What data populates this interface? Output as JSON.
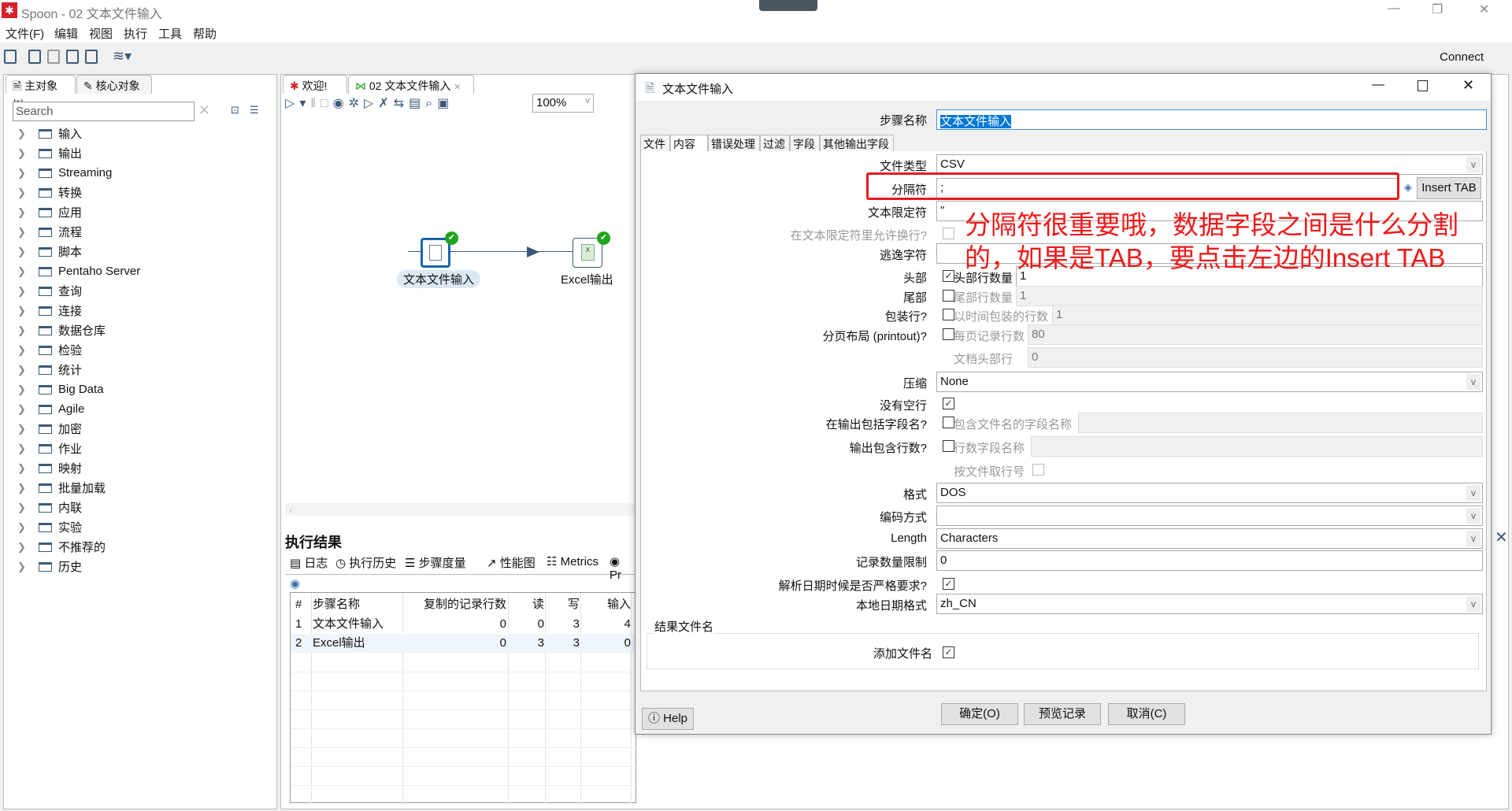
{
  "window": {
    "title": "Spoon - 02 文本文件输入",
    "minimize": "—",
    "restore": "❐",
    "close": "✕"
  },
  "menu": [
    "文件(F)",
    "编辑",
    "视图",
    "执行",
    "工具",
    "帮助"
  ],
  "toolbar": {
    "connect": "Connect"
  },
  "left_panel": {
    "tabs": [
      "主对象树",
      "核心对象"
    ],
    "search_placeholder": "Search",
    "tree": [
      "输入",
      "输出",
      "Streaming",
      "转换",
      "应用",
      "流程",
      "脚本",
      "Pentaho Server",
      "查询",
      "连接",
      "数据仓库",
      "检验",
      "统计",
      "Big Data",
      "Agile",
      "加密",
      "作业",
      "映射",
      "批量加载",
      "内联",
      "实验",
      "不推荐的",
      "历史"
    ]
  },
  "center": {
    "tabs": [
      "欢迎!",
      "02 文本文件输入"
    ],
    "zoom": "100%",
    "nodes": [
      {
        "label": "文本文件输入",
        "icon": "text-file-input-icon"
      },
      {
        "label": "Excel输出",
        "icon": "excel-output-icon"
      }
    ],
    "results": {
      "title": "执行结果",
      "tabs": [
        "日志",
        "执行历史",
        "步骤度量",
        "性能图",
        "Metrics",
        "Pr"
      ],
      "columns": [
        "#",
        "步骤名称",
        "复制的记录行数",
        "读",
        "写",
        "输入"
      ],
      "rows": [
        [
          "1",
          "文本文件输入",
          "0",
          "0",
          "3",
          "4"
        ],
        [
          "2",
          "Excel输出",
          "0",
          "3",
          "3",
          "0"
        ]
      ]
    }
  },
  "dialog": {
    "title": "文本文件输入",
    "step_name_label": "步骤名称",
    "step_name": "文本文件输入",
    "tabs": [
      "文件",
      "内容",
      "错误处理",
      "过滤",
      "字段",
      "其他输出字段"
    ],
    "active_tab": "内容",
    "fields": {
      "file_type": {
        "label": "文件类型",
        "value": "CSV"
      },
      "separator": {
        "label": "分隔符",
        "value": ";",
        "button": "Insert TAB"
      },
      "enclosure": {
        "label": "文本限定符",
        "value": "\""
      },
      "enclosure_breaks": {
        "label": "在文本限定符里允许换行?",
        "checked": false
      },
      "escape": {
        "label": "逃逸字符",
        "value": ""
      },
      "header": {
        "label": "头部",
        "checked": true,
        "sub_label": "头部行数量",
        "value": "1"
      },
      "footer": {
        "label": "尾部",
        "checked": false,
        "sub_label": "尾部行数量",
        "value": "1"
      },
      "wrap": {
        "label": "包装行?",
        "checked": false,
        "sub_label": "以时间包装的行数",
        "value": "1"
      },
      "paged": {
        "label": "分页布局 (printout)?",
        "checked": false,
        "sub_label": "每页记录行数",
        "value": "80"
      },
      "doc_header": {
        "sub_label": "文档头部行",
        "value": "0"
      },
      "compression": {
        "label": "压缩",
        "value": "None"
      },
      "no_empty": {
        "label": "没有空行",
        "checked": true
      },
      "include_filename": {
        "label": "在输出包括字段名?",
        "checked": false,
        "sub_label": "包含文件名的字段名称",
        "value": ""
      },
      "rownum": {
        "label": "输出包含行数?",
        "checked": false,
        "sub_label": "行数字段名称",
        "value": ""
      },
      "rownum_per_file": {
        "sub_label": "按文件取行号",
        "checked": false
      },
      "format": {
        "label": "格式",
        "value": "DOS"
      },
      "encoding": {
        "label": "编码方式",
        "value": ""
      },
      "length": {
        "label": "Length",
        "value": "Characters"
      },
      "limit": {
        "label": "记录数量限制",
        "value": "0"
      },
      "lenient_dates": {
        "label": "解析日期时候是否严格要求?",
        "checked": true
      },
      "locale": {
        "label": "本地日期格式",
        "value": "zh_CN"
      }
    },
    "result_group": {
      "title": "结果文件名",
      "add_filename_label": "添加文件名",
      "checked": true
    },
    "buttons": {
      "help": "Help",
      "ok": "确定(O)",
      "preview": "预览记录",
      "cancel": "取消(C)"
    }
  },
  "annotation": {
    "line1": "分隔符很重要哦，数据字段之间是什么分割",
    "line2": "的，如果是TAB，要点击左边的Insert TAB",
    "color": "#f01818"
  }
}
